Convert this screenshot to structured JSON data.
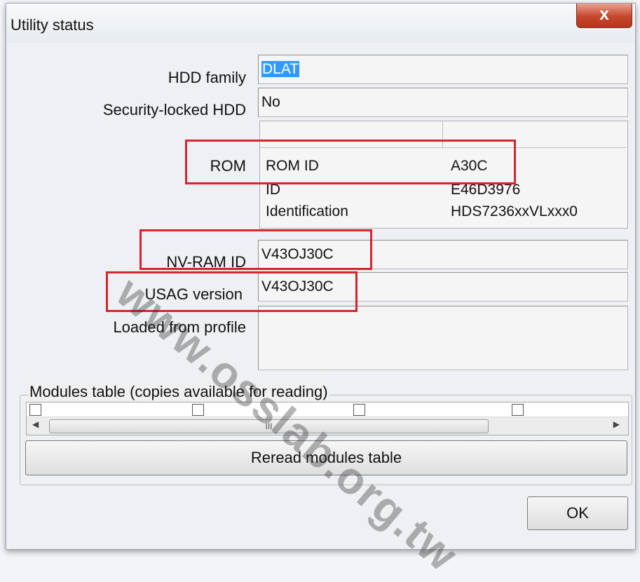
{
  "window": {
    "title": "Utility status",
    "close_glyph": "x"
  },
  "fields": {
    "hdd_family": {
      "label": "HDD family",
      "value": "DLAT"
    },
    "security_locked": {
      "label": "Security-locked HDD",
      "value": "No"
    },
    "rom": {
      "label": "ROM",
      "rows": [
        {
          "key": "ROM ID",
          "value": "A30C"
        },
        {
          "key": "ID",
          "value": "E46D3976"
        },
        {
          "key": "Identification",
          "value": "HDS7236xxVLxxx0"
        }
      ]
    },
    "nvram_id": {
      "label": "NV-RAM ID",
      "value": "V43OJ30C"
    },
    "usag_version": {
      "label": "USAG version",
      "value": "V43OJ30C"
    },
    "loaded_from_profile": {
      "label": "Loaded from profile",
      "value": ""
    }
  },
  "modules": {
    "group_title": "Modules table (copies available for reading)",
    "scroll_grip": "III",
    "reread_label": "Reread modules table"
  },
  "ok_label": "OK",
  "watermark": "www.osslab.org.tw",
  "colors": {
    "highlight_box": "#d4262e",
    "selection": "#3399ff",
    "close_button": "#c4472c"
  }
}
